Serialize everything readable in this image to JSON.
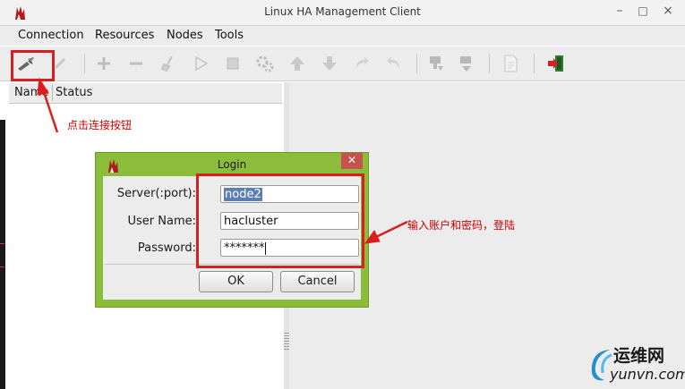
{
  "window": {
    "title": "Linux HA Management Client"
  },
  "menu": {
    "items": [
      "Connection",
      "Resources",
      "Nodes",
      "Tools"
    ]
  },
  "toolbar": {
    "tools": [
      "connect-icon",
      "disconnect-icon",
      "add-icon",
      "remove-icon",
      "cleanup-icon",
      "start-icon",
      "stop-icon",
      "manage-icon",
      "move-up-icon",
      "move-down-icon",
      "migrate-icon",
      "unmigrate-icon",
      "standby-icon",
      "active-icon",
      "report-icon",
      "exit-icon"
    ]
  },
  "tree": {
    "columns": [
      "Name",
      "Status"
    ]
  },
  "login": {
    "title": "Login",
    "server_label": "Server(:port):",
    "server_value": "node2",
    "username_label": "User Name:",
    "username_value": "hacluster",
    "password_label": "Password:",
    "password_value": "*******",
    "ok": "OK",
    "cancel": "Cancel"
  },
  "annotations": {
    "connect_hint": "点击连接按钮",
    "login_hint": "输入账户和密码，登陆"
  },
  "watermark": {
    "cn": "运维网",
    "url": "yunvn.com"
  },
  "colors": {
    "dialog_frame": "#8cbd3a",
    "annotation": "#d81e1e",
    "selection": "#5b7fb5"
  }
}
